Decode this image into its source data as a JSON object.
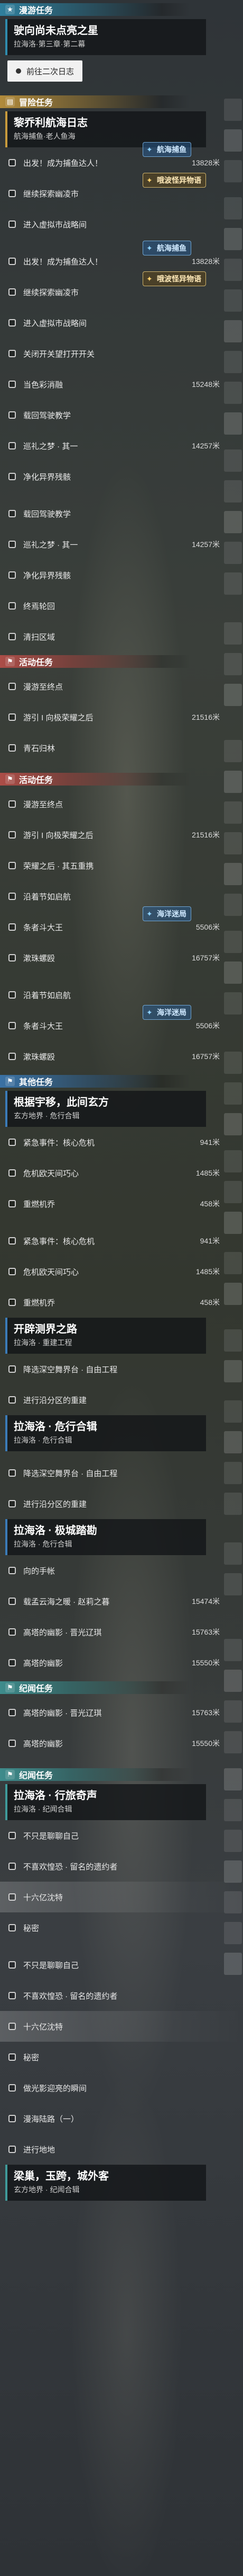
{
  "colors": {
    "ocean": "#2f8cae",
    "gold": "#c89a3c",
    "red": "#c0504a",
    "blue": "#3b7bb8",
    "teal": "#3f9a9a"
  },
  "sections": [
    {
      "type": "tag",
      "icon": "star-icon",
      "label": "漫游任务",
      "color": "#2f8cae"
    },
    {
      "type": "card",
      "title": "驶向尚未点亮之星",
      "sub": "拉海洛·第三章·第二幕",
      "color": "#2f8cae"
    },
    {
      "type": "pill",
      "label": "前往二次日志"
    },
    {
      "type": "sep"
    },
    {
      "type": "tag",
      "icon": "book-icon",
      "label": "冒险任务",
      "color": "#c89a3c"
    },
    {
      "type": "card",
      "title": "黎乔利航海日志",
      "sub": "航海捕鱼·老人鱼海",
      "color": "#c89a3c"
    },
    {
      "type": "row",
      "label": "出发！成为捕鱼达人！",
      "dist": "13828米",
      "badge": "航海捕鱼",
      "badgeStyle": "blue"
    },
    {
      "type": "row",
      "label": "继续探索幽凌市",
      "dist": "",
      "badge": "哦波怪异物语",
      "badgeStyle": "gold"
    },
    {
      "type": "row",
      "label": "进入虚拟市战略间",
      "dist": ""
    },
    {
      "type": "sep"
    },
    {
      "type": "row",
      "label": "出发！成为捕鱼达人！",
      "dist": "13828米",
      "badge": "航海捕鱼",
      "badgeStyle": "blue"
    },
    {
      "type": "row",
      "label": "继续探索幽凌市",
      "dist": "",
      "badge": "哦波怪异物语",
      "badgeStyle": "gold"
    },
    {
      "type": "row",
      "label": "进入虚拟市战略间",
      "dist": ""
    },
    {
      "type": "row",
      "label": "关闭开关望打开开关",
      "dist": ""
    },
    {
      "type": "row",
      "label": "当色彩消融",
      "dist": "15248米"
    },
    {
      "type": "row",
      "label": "载回驾驶教学",
      "dist": ""
    },
    {
      "type": "row",
      "label": "巡礼之梦 · 其一",
      "dist": "14257米"
    },
    {
      "type": "row",
      "label": "净化异界残骸",
      "dist": ""
    },
    {
      "type": "sep"
    },
    {
      "type": "row",
      "label": "载回驾驶教学",
      "dist": ""
    },
    {
      "type": "row",
      "label": "巡礼之梦 · 其一",
      "dist": "14257米"
    },
    {
      "type": "row",
      "label": "净化异界残骸",
      "dist": ""
    },
    {
      "type": "row",
      "label": "终焉轮回",
      "dist": ""
    },
    {
      "type": "row",
      "label": "清扫区域",
      "dist": ""
    },
    {
      "type": "tag",
      "icon": "flag-icon",
      "label": "活动任务",
      "color": "#c0504a"
    },
    {
      "type": "row",
      "label": "漫游至终点",
      "dist": ""
    },
    {
      "type": "row",
      "label": "游引 I 向极荣耀之后",
      "dist": "21516米"
    },
    {
      "type": "row",
      "label": "青石归林",
      "dist": ""
    },
    {
      "type": "sep"
    },
    {
      "type": "tag",
      "icon": "flag-icon",
      "label": "活动任务",
      "color": "#c0504a"
    },
    {
      "type": "row",
      "label": "漫游至终点",
      "dist": ""
    },
    {
      "type": "row",
      "label": "游引 I 向极荣耀之后",
      "dist": "21516米"
    },
    {
      "type": "row",
      "label": "荣耀之后 · 其五重携",
      "dist": ""
    },
    {
      "type": "row",
      "label": "沿着节如启航",
      "dist": ""
    },
    {
      "type": "row",
      "label": "条者斗大王",
      "dist": "5506米",
      "badge": "海洋迷局",
      "badgeStyle": "blue"
    },
    {
      "type": "row",
      "label": "漱珠螺殴",
      "dist": "16757米"
    },
    {
      "type": "sep"
    },
    {
      "type": "row",
      "label": "沿着节如启航",
      "dist": ""
    },
    {
      "type": "row",
      "label": "条者斗大王",
      "dist": "5506米",
      "badge": "海洋迷局",
      "badgeStyle": "blue"
    },
    {
      "type": "row",
      "label": "漱珠螺殴",
      "dist": "16757米"
    },
    {
      "type": "tag",
      "icon": "flag-icon",
      "label": "其他任务",
      "color": "#3b7bb8"
    },
    {
      "type": "card",
      "title": "根据宇移，此间玄方",
      "sub": "玄方地界 · 危行合辑",
      "color": "#3b7bb8"
    },
    {
      "type": "row",
      "label": "紧急事件：核心危机",
      "dist": "941米"
    },
    {
      "type": "row",
      "label": "危机欧天间巧心",
      "dist": "1485米"
    },
    {
      "type": "row",
      "label": "重燃机乔",
      "dist": "458米"
    },
    {
      "type": "sep"
    },
    {
      "type": "row",
      "label": "紧急事件：核心危机",
      "dist": "941米"
    },
    {
      "type": "row",
      "label": "危机欧天间巧心",
      "dist": "1485米"
    },
    {
      "type": "row",
      "label": "重燃机乔",
      "dist": "458米"
    },
    {
      "type": "card",
      "title": "开辟测界之路",
      "sub": "拉海洛 · 重建工程",
      "color": "#3b7bb8"
    },
    {
      "type": "row",
      "label": "降选深空舞界台 · 自由工程",
      "dist": ""
    },
    {
      "type": "row",
      "label": "进行沿分区的重建",
      "dist": ""
    },
    {
      "type": "card",
      "title": "拉海洛 · 危行合辑",
      "sub": "拉海洛 · 危行合辑",
      "color": "#3b7bb8"
    },
    {
      "type": "sep"
    },
    {
      "type": "row",
      "label": "降选深空舞界台 · 自由工程",
      "dist": ""
    },
    {
      "type": "row",
      "label": "进行沿分区的重建",
      "dist": ""
    },
    {
      "type": "card",
      "title": "拉海洛 · 极城踏勘",
      "sub": "拉海洛 · 危行合辑",
      "color": "#3b7bb8"
    },
    {
      "type": "row",
      "label": "向的手帐",
      "dist": ""
    },
    {
      "type": "row",
      "label": "载孟云海之暖 · 赵莉之暮",
      "dist": "15474米"
    },
    {
      "type": "row",
      "label": "高塔的幽影 · 晋光辽琪",
      "dist": "15763米"
    },
    {
      "type": "row",
      "label": "高塔的幽影",
      "dist": "15550米"
    },
    {
      "type": "tag",
      "icon": "flag-icon",
      "label": "纪闻任务",
      "color": "#3f9a9a"
    },
    {
      "type": "row",
      "label": "高塔的幽影 · 晋光辽琪",
      "dist": "15763米"
    },
    {
      "type": "row",
      "label": "高塔的幽影",
      "dist": "15550米"
    },
    {
      "type": "sep"
    },
    {
      "type": "tag",
      "icon": "flag-icon",
      "label": "纪闻任务",
      "color": "#3f9a9a"
    },
    {
      "type": "card",
      "title": "拉海洛 · 行旅奇声",
      "sub": "拉海洛 · 纪闻合辑",
      "color": "#3f9a9a"
    },
    {
      "type": "row",
      "label": "不只是聊聊自己",
      "dist": ""
    },
    {
      "type": "row",
      "label": "不喜欢惶恐 · 留名的遗约者",
      "dist": ""
    },
    {
      "type": "row",
      "label": "十六亿沈特",
      "dist": "",
      "sel": true
    },
    {
      "type": "row",
      "label": "秘密",
      "dist": ""
    },
    {
      "type": "sep"
    },
    {
      "type": "row",
      "label": "不只是聊聊自己",
      "dist": ""
    },
    {
      "type": "row",
      "label": "不喜欢惶恐 · 留名的遗约者",
      "dist": ""
    },
    {
      "type": "row",
      "label": "十六亿沈特",
      "dist": "",
      "sel": true
    },
    {
      "type": "row",
      "label": "秘密",
      "dist": ""
    },
    {
      "type": "row",
      "label": "做光影迎亮的瞬间",
      "dist": ""
    },
    {
      "type": "row",
      "label": "漫海陆路（一）",
      "dist": ""
    },
    {
      "type": "row",
      "label": "进行地地",
      "dist": ""
    },
    {
      "type": "card",
      "title": "梁巢，玉跨，城外客",
      "sub": "玄方地界 · 纪闻合辑",
      "color": "#3f9a9a"
    }
  ]
}
